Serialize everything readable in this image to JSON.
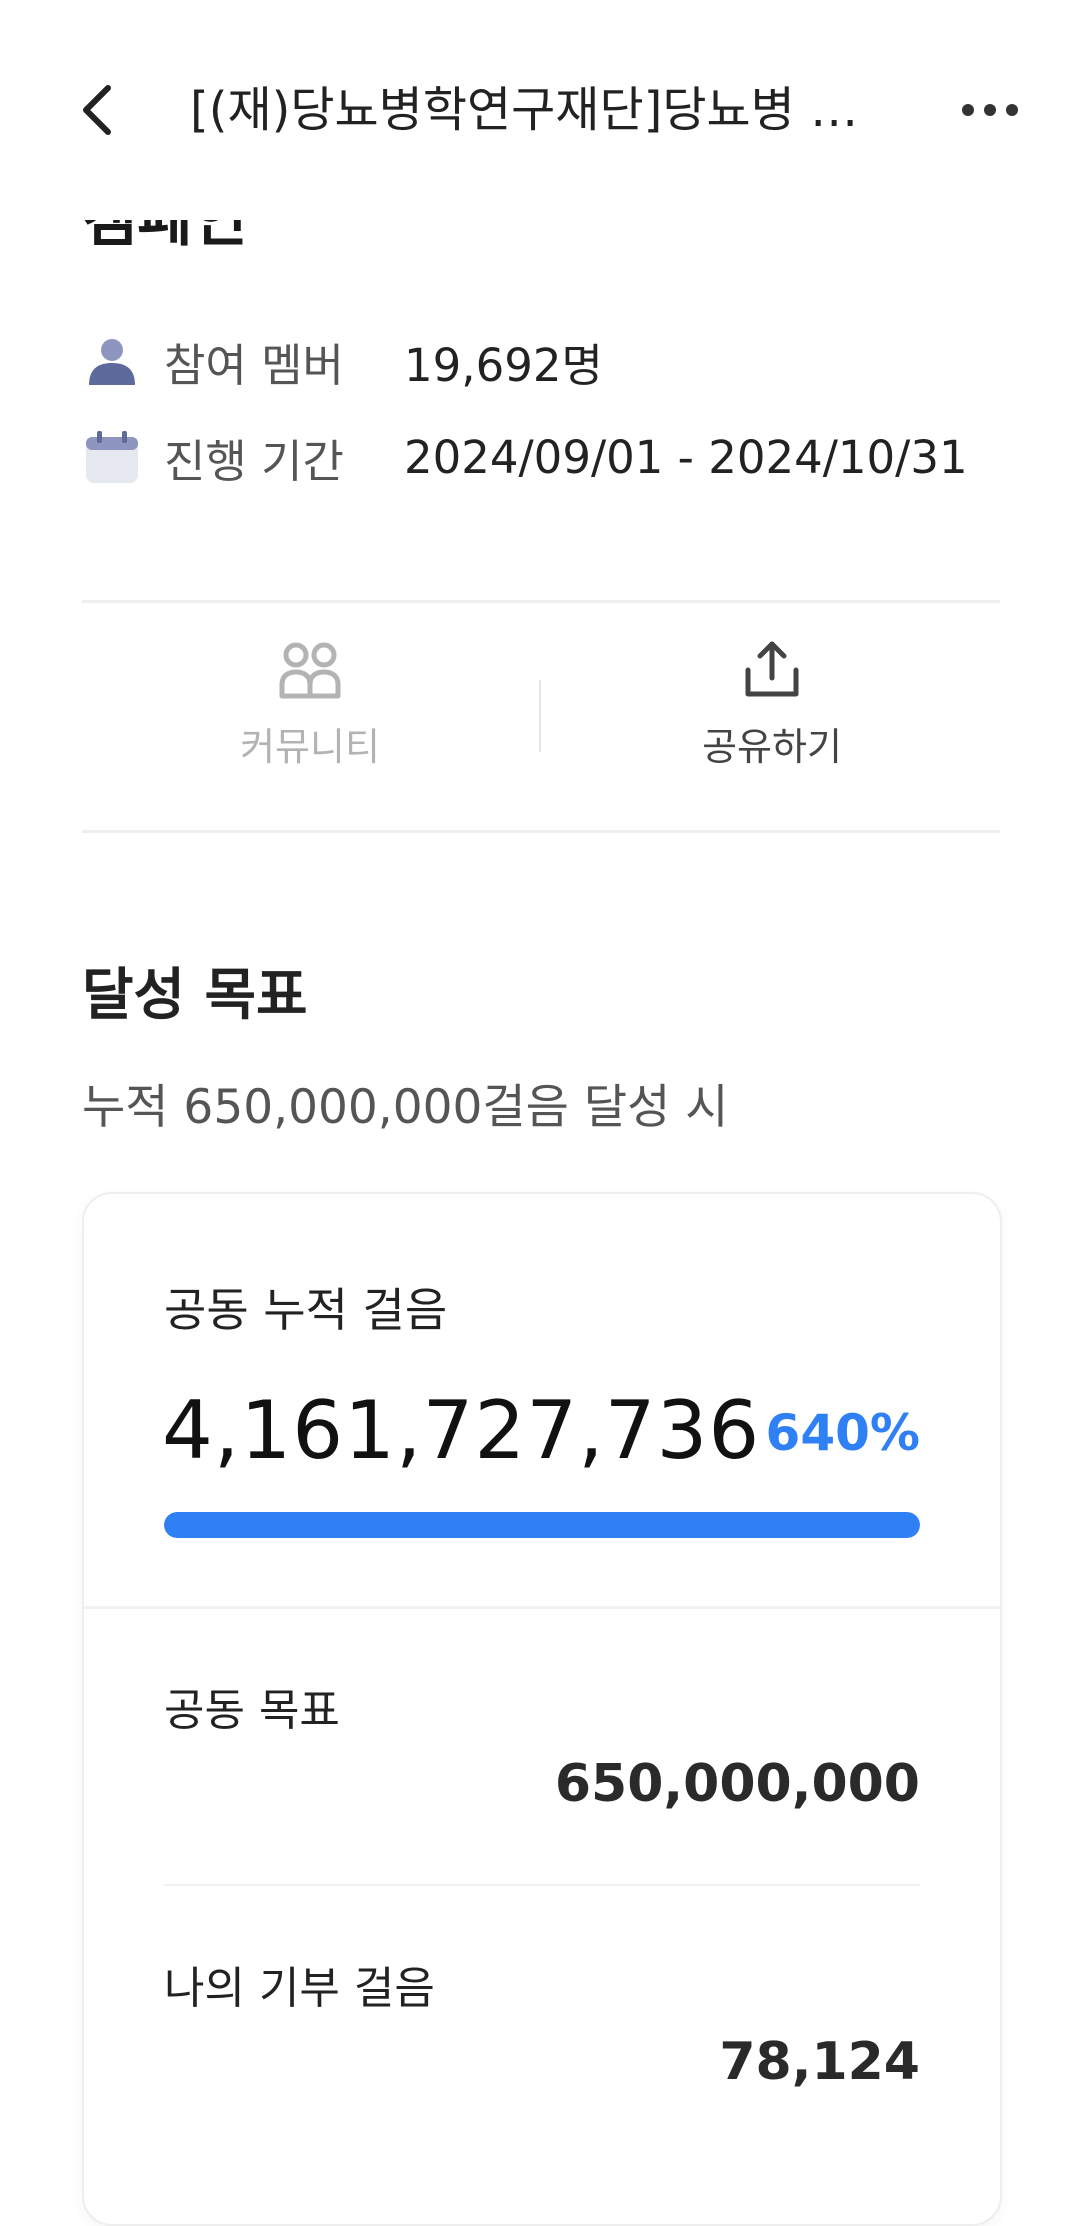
{
  "header": {
    "title": "[(재)당뇨병학연구재단]당뇨병 걷기 캠페인"
  },
  "campaign": {
    "title_partial": "캠페인"
  },
  "info": {
    "members_label": "참여 멤버",
    "members_value": "19,692명",
    "period_label": "진행 기간",
    "period_value": "2024/09/01 - 2024/10/31"
  },
  "actions": {
    "community_label": "커뮤니티",
    "share_label": "공유하기"
  },
  "goal": {
    "title": "달성 목표",
    "subtitle": "누적 650,000,000걸음 달성 시",
    "total_label": "공동 누적 걸음",
    "total_value": "4,161,727,736",
    "percent": "640%",
    "progress_fraction": 1.0,
    "target_label": "공동 목표",
    "target_value": "650,000,000",
    "my_label": "나의 기부 걸음",
    "my_value": "78,124"
  },
  "colors": {
    "accent": "#2f80f5",
    "icon_member": "#5f6a9c",
    "icon_inactive": "#b3b3b3"
  },
  "icons": {
    "back": "chevron-left-icon",
    "more": "more-horizontal-icon",
    "member": "person-icon",
    "calendar": "calendar-icon",
    "community": "people-icon",
    "share": "share-upload-icon"
  }
}
